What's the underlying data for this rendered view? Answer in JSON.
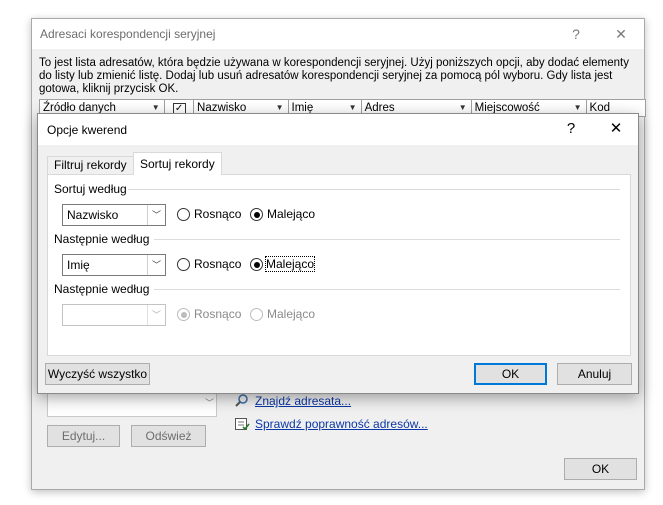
{
  "back_window": {
    "title": "Adresaci korespondencji seryjnej",
    "help_glyph": "?",
    "close_glyph": "✕",
    "description": "To jest lista adresatów, która będzie używana w korespondencji seryjnej. Użyj poniższych opcji, aby dodać elementy do listy lub zmienić listę. Dodaj lub usuń adresatów korespondencji seryjnej za pomocą pól wyboru. Gdy lista jest gotowa, kliknij przycisk OK.",
    "columns": [
      "Źródło danych",
      "",
      "Nazwisko",
      "Imię",
      "Adres",
      "Miejscowość",
      "Kod"
    ],
    "links": {
      "find_recipient": "Znajdź adresata...",
      "validate_addresses": "Sprawdź poprawność adresów..."
    },
    "buttons": {
      "edit": "Edytuj...",
      "refresh": "Odśwież",
      "ok": "OK"
    }
  },
  "dialog": {
    "title": "Opcje kwerend",
    "help_glyph": "?",
    "close_glyph": "✕",
    "tabs": [
      "Filtruj rekordy",
      "Sortuj rekordy"
    ],
    "active_tab": "Sortuj rekordy",
    "sort_groups": [
      {
        "label": "Sortuj według",
        "field": "Nazwisko",
        "ascending": "Rosnąco",
        "descending": "Malejąco",
        "selected": "descending",
        "enabled": true
      },
      {
        "label": "Następnie według",
        "field": "Imię",
        "ascending": "Rosnąco",
        "descending": "Malejąco",
        "selected": "descending",
        "enabled": true
      },
      {
        "label": "Następnie według",
        "field": "",
        "ascending": "Rosnąco",
        "descending": "Malejąco",
        "selected": "ascending",
        "enabled": false
      }
    ],
    "buttons": {
      "clear_all": "Wyczyść wszystko",
      "ok": "OK",
      "cancel": "Anuluj"
    }
  },
  "icons": {
    "find": "magnifier-icon",
    "validate": "checklist-icon",
    "dropdown": "chevron-down-icon"
  }
}
